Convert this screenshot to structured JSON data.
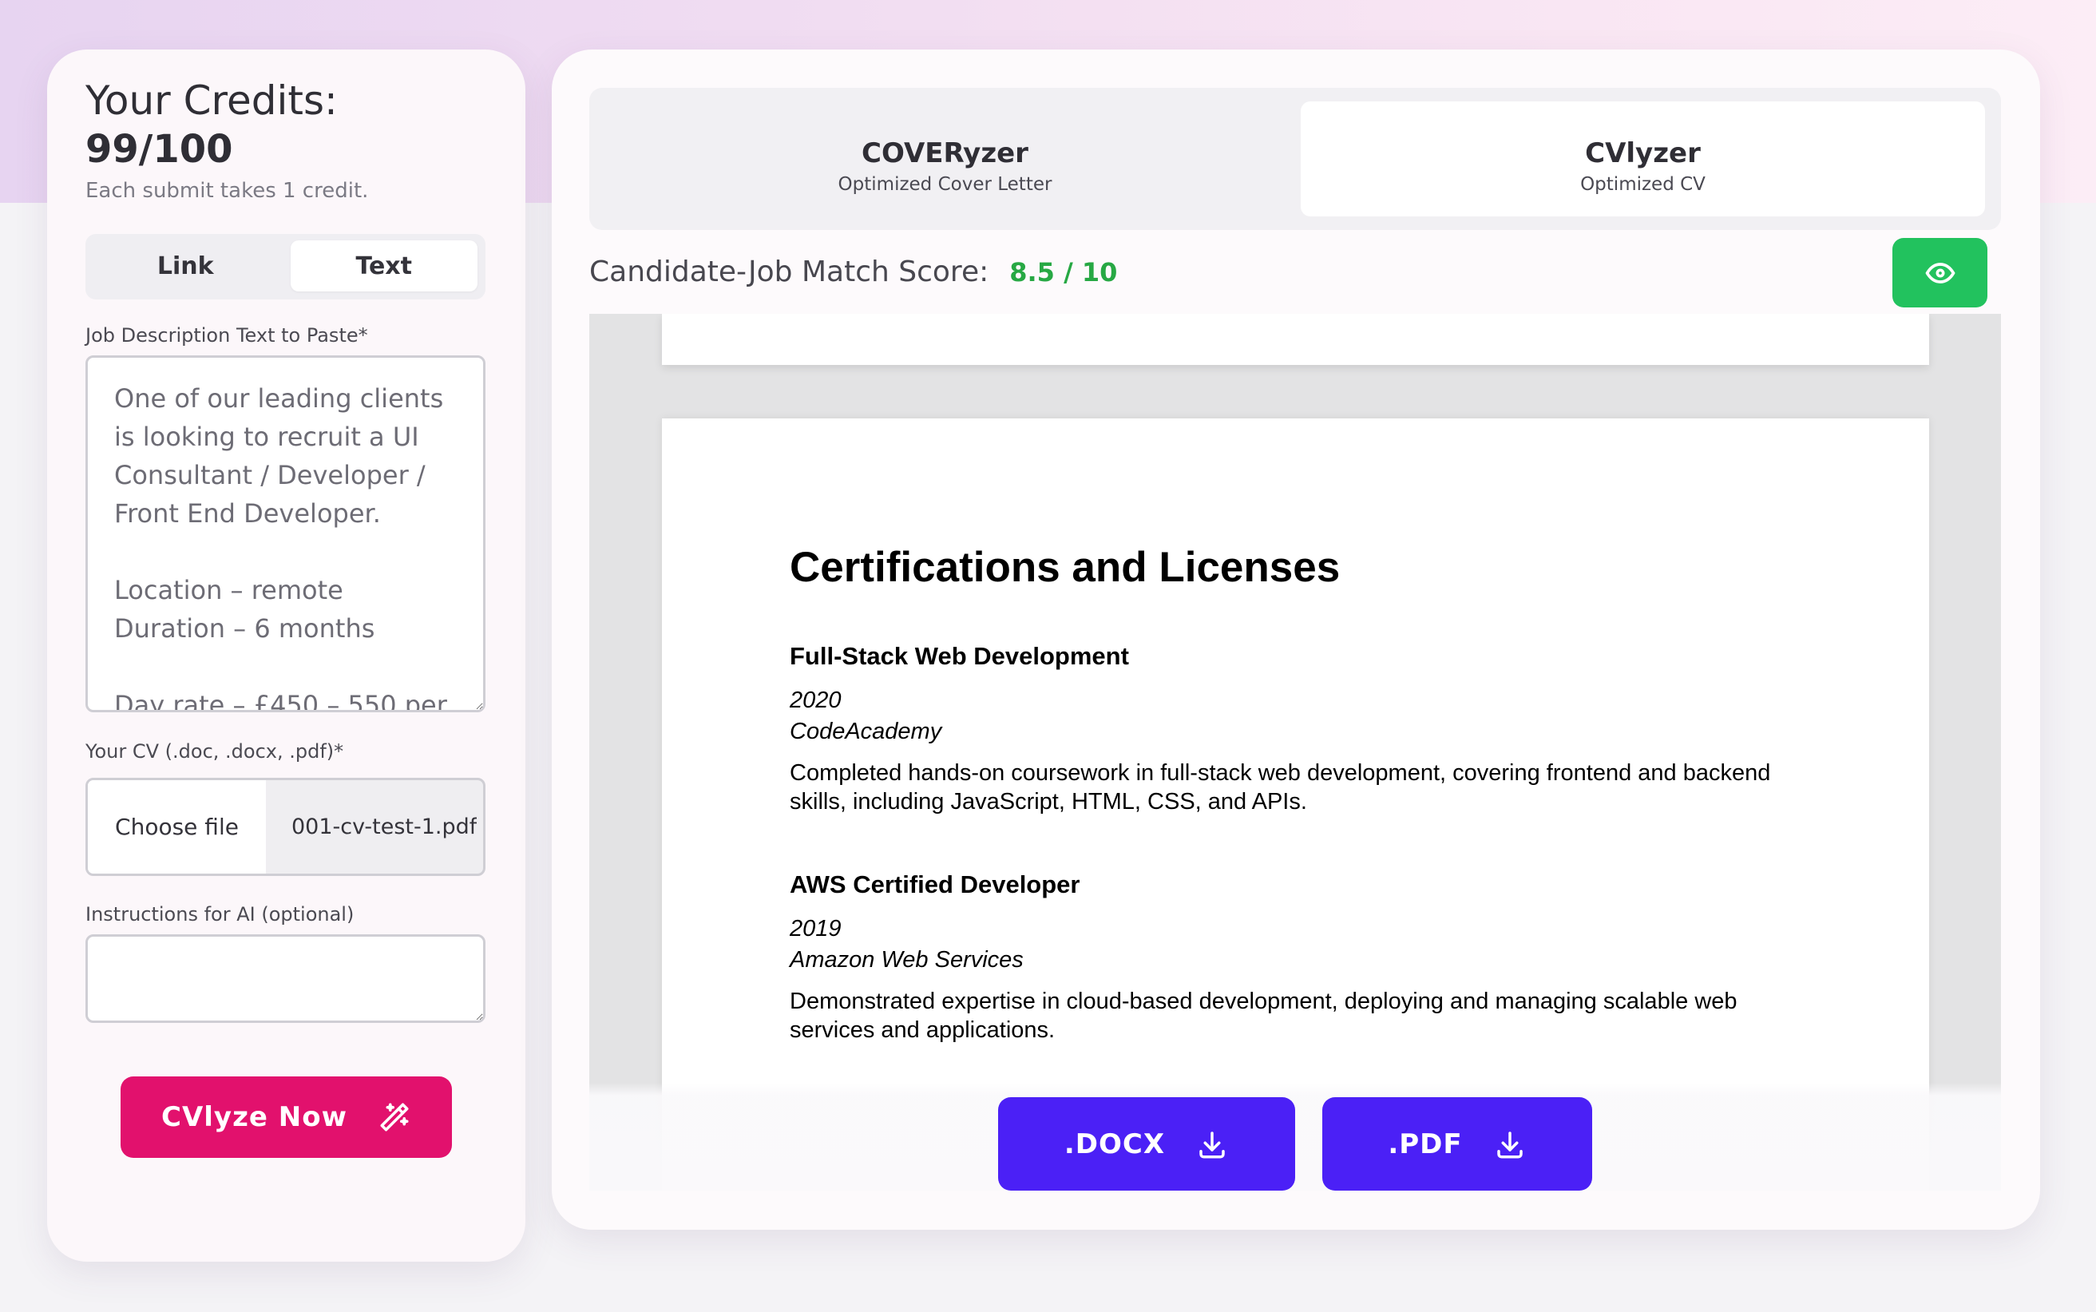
{
  "credits": {
    "title": "Your Credits:",
    "value": "99/100",
    "note": "Each submit takes 1 credit."
  },
  "input_mode_tabs": [
    {
      "label": "Link",
      "active": false
    },
    {
      "label": "Text",
      "active": true
    }
  ],
  "job_description": {
    "label": "Job Description Text to Paste*",
    "value": "One of our leading clients is looking to recruit a UI Consultant / Developer / Front End Developer.\n\nLocation – remote\nDuration – 6 months\n\nDay rate – £450 – 550 per"
  },
  "cv_upload": {
    "label": "Your CV (.doc, .docx, .pdf)*",
    "button_label": "Choose file",
    "file_name": "001-cv-test-1.pdf"
  },
  "ai_instructions": {
    "label": "Instructions for AI (optional)",
    "value": ""
  },
  "submit_button": {
    "label": "CVlyze Now",
    "icon": "magic-wand-icon"
  },
  "product_tabs": [
    {
      "title": "COVERyzer",
      "subtitle": "Optimized Cover Letter",
      "active": false
    },
    {
      "title": "CVlyzer",
      "subtitle": "Optimized CV",
      "active": true
    }
  ],
  "match_score": {
    "label": "Candidate-Job Match Score:",
    "value": "8.5 / 10"
  },
  "preview_toggle": {
    "icon": "eye-icon"
  },
  "cv_preview": {
    "section_heading": "Certifications and Licenses",
    "entries": [
      {
        "title": "Full-Stack Web Development",
        "year": "2020",
        "issuer": "CodeAcademy",
        "description": "Completed hands-on coursework in full-stack web development, covering frontend and backend skills, including JavaScript, HTML, CSS, and APIs."
      },
      {
        "title": "AWS Certified Developer",
        "year": "2019",
        "issuer": "Amazon Web Services",
        "description": "Demonstrated expertise in cloud-based development, deploying and managing scalable web services and applications."
      }
    ]
  },
  "downloads": [
    {
      "label": ".DOCX",
      "icon": "download-icon"
    },
    {
      "label": ".PDF",
      "icon": "download-icon"
    }
  ],
  "colors": {
    "accent_pink": "#e2116d",
    "accent_purple": "#4b20f6",
    "success_green": "#22c25e",
    "score_green": "#27a844"
  }
}
